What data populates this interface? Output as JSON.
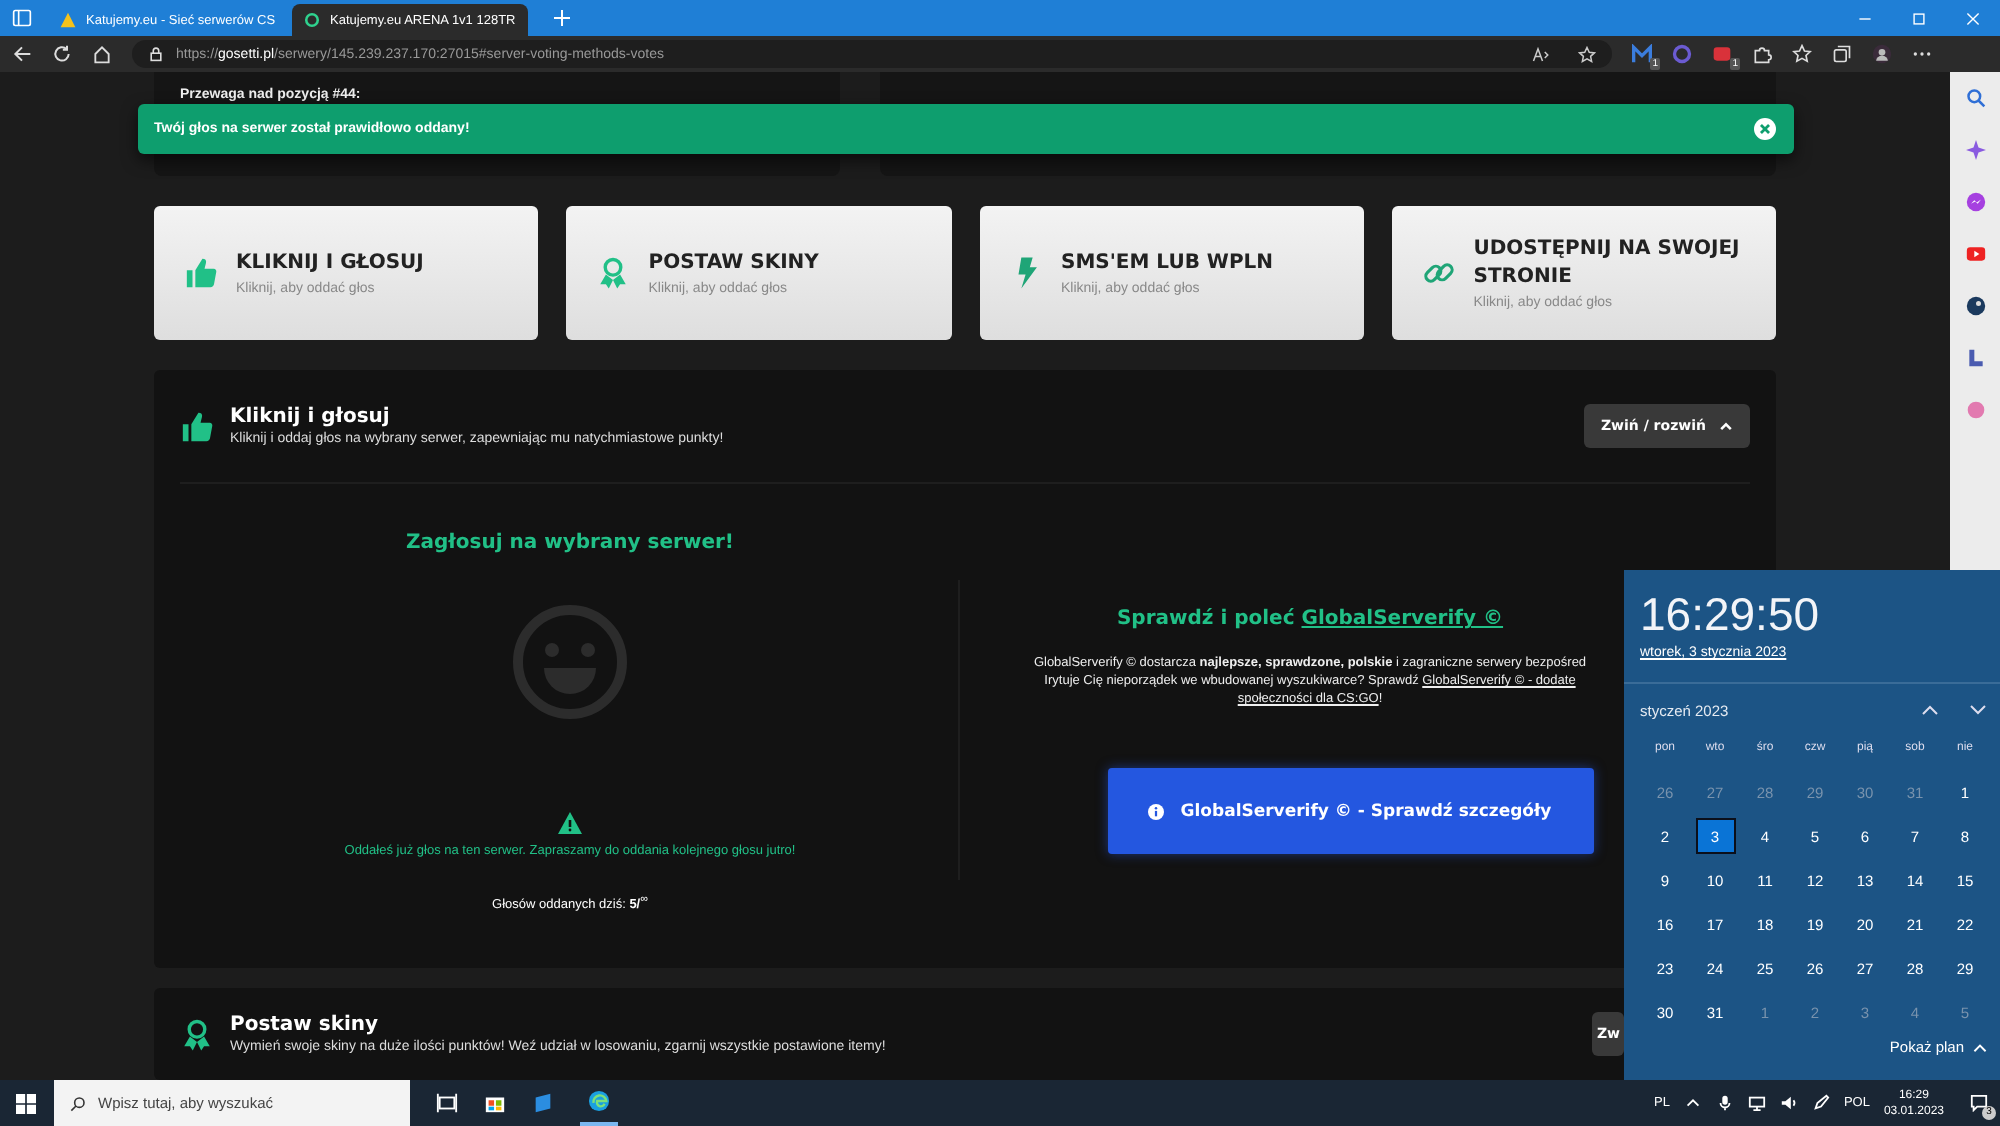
{
  "browser": {
    "tabs": [
      {
        "title": "Katujemy.eu - Sieć serwerów CS",
        "selected": false,
        "kind": "warn"
      },
      {
        "title": "Katujemy.eu ARENA 1v1 128TR",
        "selected": true,
        "kind": "ring"
      }
    ],
    "url": [
      {
        "text": "https://",
        "kind": "dim"
      },
      {
        "text": "gosetti.pl",
        "kind": "host"
      },
      {
        "text": "/serwery/145.239.237.170:27015#server-voting-methods-votes",
        "kind": "dim"
      }
    ],
    "extensions": [
      {
        "kind": "m",
        "badge": "1"
      },
      {
        "kind": "circle"
      },
      {
        "kind": "red",
        "badge": "1"
      }
    ]
  },
  "page": {
    "top_label": "Przewaga nad pozycją #44:",
    "toast": {
      "text": "Twój głos na serwer został prawidłowo oddany!"
    },
    "method_cards": [
      {
        "kind": "thumb",
        "title": "KLIKNIJ I GŁOSUJ",
        "subtitle": "Kliknij, aby oddać głos"
      },
      {
        "kind": "award",
        "title": "POSTAW SKINY",
        "subtitle": "Kliknij, aby oddać głos"
      },
      {
        "kind": "bolt",
        "title": "SMS'EM LUB WPLN",
        "subtitle": "Kliknij, aby oddać głos"
      },
      {
        "kind": "link",
        "title": "UDOSTĘPNIJ NA SWOJEJ STRONIE",
        "subtitle": "Kliknij, aby oddać głos"
      }
    ],
    "vote_section": {
      "kind": "thumb",
      "title": "Kliknij i głosuj",
      "subtitle": "Kliknij i oddaj głos na wybrany serwer, zapewniając mu natychmiastowe punkty!",
      "toggle": "Zwiń / rozwiń",
      "expanded": true,
      "left": {
        "heading": "Zagłosuj na wybrany serwer!",
        "notice": "Oddałeś już głos na ten serwer. Zapraszamy do oddania kolejnego głosu jutro!",
        "votes_today": "Głosów oddanych dziś: **5/**$^{∞}$"
      },
      "right": {
        "heading": [
          {
            "text": "Sprawdź i poleć ",
            "kind": "text"
          },
          {
            "text": "GlobalServerify ©",
            "kind": "link"
          }
        ],
        "paragraph": [
          [
            {
              "text": "GlobalServerify © dostarcza ",
              "kind": "text"
            },
            {
              "text": "najlepsze, sprawdzone, polskie",
              "kind": "bold"
            },
            {
              "text": " i zagraniczne serwery bezpośred",
              "kind": "text"
            }
          ],
          [
            {
              "text": "Irytuje Cię nieporządek we wbudowanej wyszukiwarce? Sprawdź ",
              "kind": "text"
            },
            {
              "text": "GlobalServerify © - dodate",
              "kind": "link"
            }
          ],
          [
            {
              "text": "społeczności dla CS:GO",
              "kind": "link"
            },
            {
              "text": "!",
              "kind": "text"
            }
          ]
        ],
        "button": "GlobalServerify © - Sprawdź szczegóły"
      }
    },
    "next_section": {
      "kind": "award",
      "title": "Postaw skiny",
      "subtitle": "Wymień swoje skiny na duże ilości punktów! Weź udział w losowaniu, zgarnij wszystkie postawione itemy!",
      "toggle": "Zw"
    }
  },
  "calendar": {
    "time": "16:29:50",
    "date": "wtorek, 3 stycznia 2023",
    "month": "styczeń 2023",
    "weekdays": [
      "pon",
      "wto",
      "śro",
      "czw",
      "pią",
      "sob",
      "nie"
    ],
    "days": [
      {
        "label": "26",
        "muted": true,
        "selected": false
      },
      {
        "label": "27",
        "muted": true,
        "selected": false
      },
      {
        "label": "28",
        "muted": true,
        "selected": false
      },
      {
        "label": "29",
        "muted": true,
        "selected": false
      },
      {
        "label": "30",
        "muted": true,
        "selected": false
      },
      {
        "label": "31",
        "muted": true,
        "selected": false
      },
      {
        "label": "1",
        "muted": false,
        "selected": false
      },
      {
        "label": "2",
        "muted": false,
        "selected": false
      },
      {
        "label": "3",
        "muted": false,
        "selected": true
      },
      {
        "label": "4",
        "muted": false,
        "selected": false
      },
      {
        "label": "5",
        "muted": false,
        "selected": false
      },
      {
        "label": "6",
        "muted": false,
        "selected": false
      },
      {
        "label": "7",
        "muted": false,
        "selected": false
      },
      {
        "label": "8",
        "muted": false,
        "selected": false
      },
      {
        "label": "9",
        "muted": false,
        "selected": false
      },
      {
        "label": "10",
        "muted": false,
        "selected": false
      },
      {
        "label": "11",
        "muted": false,
        "selected": false
      },
      {
        "label": "12",
        "muted": false,
        "selected": false
      },
      {
        "label": "13",
        "muted": false,
        "selected": false
      },
      {
        "label": "14",
        "muted": false,
        "selected": false
      },
      {
        "label": "15",
        "muted": false,
        "selected": false
      },
      {
        "label": "16",
        "muted": false,
        "selected": false
      },
      {
        "label": "17",
        "muted": false,
        "selected": false
      },
      {
        "label": "18",
        "muted": false,
        "selected": false
      },
      {
        "label": "19",
        "muted": false,
        "selected": false
      },
      {
        "label": "20",
        "muted": false,
        "selected": false
      },
      {
        "label": "21",
        "muted": false,
        "selected": false
      },
      {
        "label": "22",
        "muted": false,
        "selected": false
      },
      {
        "label": "23",
        "muted": false,
        "selected": false
      },
      {
        "label": "24",
        "muted": false,
        "selected": false
      },
      {
        "label": "25",
        "muted": false,
        "selected": false
      },
      {
        "label": "26",
        "muted": false,
        "selected": false
      },
      {
        "label": "27",
        "muted": false,
        "selected": false
      },
      {
        "label": "28",
        "muted": false,
        "selected": false
      },
      {
        "label": "29",
        "muted": false,
        "selected": false
      },
      {
        "label": "30",
        "muted": false,
        "selected": false
      },
      {
        "label": "31",
        "muted": false,
        "selected": false
      },
      {
        "label": "1",
        "muted": true,
        "selected": false
      },
      {
        "label": "2",
        "muted": true,
        "selected": false
      },
      {
        "label": "3",
        "muted": true,
        "selected": false
      },
      {
        "label": "4",
        "muted": true,
        "selected": false
      },
      {
        "label": "5",
        "muted": true,
        "selected": false
      }
    ],
    "agenda": "Pokaż plan"
  },
  "taskbar": {
    "search_placeholder": "Wpisz tutaj, aby wyszukać",
    "input_lang": "PL",
    "keyboard": "POL",
    "time": "16:29",
    "date": "03.01.2023",
    "notifications": "3"
  }
}
